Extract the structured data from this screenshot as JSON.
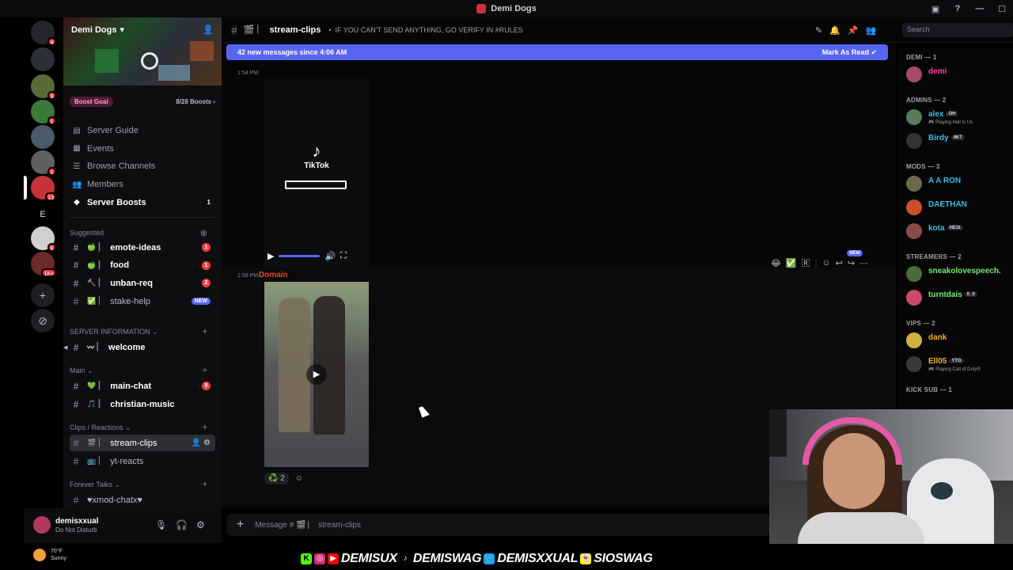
{
  "window": {
    "title": "Demi Dogs"
  },
  "rail": {
    "servers": [
      {
        "name": "discord-home",
        "color": "#23272a",
        "badge": "4"
      },
      {
        "name": "server-r",
        "color": "#2c2f35",
        "badge": ""
      },
      {
        "name": "server-3",
        "color": "#5a6b3a",
        "badge": "3"
      },
      {
        "name": "server-4",
        "color": "#3c7a3a",
        "badge": "1"
      },
      {
        "name": "server-5",
        "color": "#4a5a6a",
        "badge": ""
      },
      {
        "name": "server-6",
        "color": "#606060",
        "badge": "1"
      },
      {
        "name": "server-demi",
        "color": "#c8323b",
        "badge": "13"
      },
      {
        "name": "server-e",
        "color": "#1e1f22",
        "badge": ""
      },
      {
        "name": "server-8",
        "color": "#d0d0d0",
        "badge": "6"
      },
      {
        "name": "server-9",
        "color": "#6e2a2a",
        "badge": "1K+"
      }
    ],
    "e_letter": "E"
  },
  "sidebar": {
    "guild_name": "Demi Dogs",
    "boost_goal_label": "Boost Goal",
    "boost_count": "8/28 Boosts",
    "nav": [
      {
        "label": "Server Guide",
        "icon": "guide-icon"
      },
      {
        "label": "Events",
        "icon": "calendar-icon"
      },
      {
        "label": "Browse Channels",
        "icon": "browse-icon"
      },
      {
        "label": "Members",
        "icon": "members-icon"
      },
      {
        "label": "Server Boosts",
        "icon": "boost-icon",
        "count": "1"
      }
    ],
    "suggested_label": "Suggested",
    "suggested": [
      {
        "name": "emote-ideas",
        "emoji": "🍏",
        "badge": "1"
      },
      {
        "name": "food",
        "emoji": "🍏",
        "badge": "1"
      },
      {
        "name": "unban-req",
        "emoji": "🔨",
        "badge": "2"
      },
      {
        "name": "stake-help",
        "emoji": "✅",
        "badge": "NEW"
      }
    ],
    "cat_server_info": "SERVER INFORMATION",
    "welcome": {
      "name": "welcome",
      "emoji": "〰"
    },
    "cat_main": "Main",
    "main_chat": {
      "name": "main-chat",
      "emoji": "💚",
      "badge": "9"
    },
    "christian_music": {
      "name": "christian-music",
      "emoji": "🎵"
    },
    "cat_clips": "Clips / Reactions",
    "stream_clips": {
      "name": "stream-clips",
      "emoji": "🎬"
    },
    "yt_reacts": {
      "name": "yt-reacts",
      "emoji": "📺"
    },
    "cat_forever": "Forever Talks",
    "mod_chat": {
      "name": "♥︎xmod-chatx♥︎"
    }
  },
  "user_panel": {
    "username": "demisxxual",
    "status": "Do Not Disturb"
  },
  "header": {
    "channel": "stream-clips",
    "topic": "IF YOU CAN'T SEND ANYTHING, GO VERIFY IN #RULES",
    "search_placeholder": "Search"
  },
  "chat": {
    "new_messages": "42 new messages since 4:06 AM",
    "mark_as_read": "Mark As Read",
    "msg1_time": "1:54 PM",
    "tiktok_label": "TikTok",
    "msg2_time": "1:58 PM",
    "msg2_author": "Domain",
    "reaction_count": "2",
    "toolbar_new": "NEW",
    "composer_placeholder": "Message # 🎬 ⎸ stream-clips"
  },
  "members": {
    "groups": [
      {
        "label": "DEMI — 1",
        "members": [
          {
            "name": "demi",
            "color": "#ff3fa4",
            "avatar": "#a84a6a"
          }
        ]
      },
      {
        "label": "ADMINS — 2",
        "members": [
          {
            "name": "alex",
            "color": "#3fbbe8",
            "avatar": "#5a7a5a",
            "tag": "OH",
            "activity": "Playing Hell Is Us"
          },
          {
            "name": "Birdy",
            "color": "#3fbbe8",
            "avatar": "#333",
            "tag": "4KT"
          }
        ]
      },
      {
        "label": "MODS — 3",
        "members": [
          {
            "name": "A A RON",
            "color": "#3fbbe8",
            "avatar": "#6a6a4a"
          },
          {
            "name": "DAETHAN",
            "color": "#3fbbe8",
            "avatar": "#c8502a"
          },
          {
            "name": "kota",
            "color": "#3fbbe8",
            "avatar": "#8a4a4a",
            "tag": "HESI"
          }
        ]
      },
      {
        "label": "STREAMERS — 2",
        "members": [
          {
            "name": "sneakolovespeech.",
            "color": "#7ee87e",
            "avatar": "#4a6a3a"
          },
          {
            "name": "turntdais",
            "color": "#7ee87e",
            "avatar": "#c84a6a",
            "tag": "0_0"
          }
        ]
      },
      {
        "label": "VIPS — 2",
        "members": [
          {
            "name": "dank",
            "color": "#f0b232",
            "avatar": "#d0b040"
          },
          {
            "name": "Ell05",
            "color": "#f0b232",
            "avatar": "#3a3a3a",
            "tag": "YTG",
            "activity": "Playing Call of Duty®"
          }
        ]
      },
      {
        "label": "KICK SUB — 1",
        "members": []
      }
    ]
  },
  "overlay": {
    "temp": "70°F",
    "weather": "Sunny",
    "socials": [
      "DEMISUX",
      "DEMISWAG",
      "DEMISXXUAL",
      "SIOSWAG"
    ]
  }
}
